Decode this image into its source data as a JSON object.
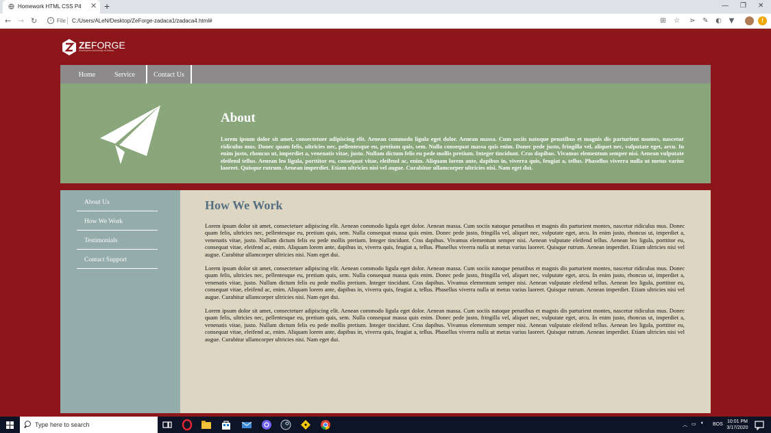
{
  "browser": {
    "tab_title": "Homework HTML CSS P4",
    "tab_close": "✕",
    "new_tab": "+",
    "scheme_label": "File",
    "url": "C:/Users/ALeN/Desktop/ZeForge-zadaca1/zadaca4.html#",
    "back": "←",
    "forward": "→",
    "reload": "↻"
  },
  "window_controls": {
    "minimize": "—",
    "restore": "❐",
    "close": "✕"
  },
  "logo": {
    "brand_bold": "ZE",
    "brand_rest": "FORGE",
    "tagline": "Developers community of Zenica"
  },
  "nav": {
    "items": [
      "Home",
      "Service",
      "Contact Us"
    ]
  },
  "hero": {
    "title": "About",
    "text": "Lorem ipsum dolor sit amet, consectetuer adipiscing elit. Aenean commodo ligula eget dolor. Aenean massa. Cum sociis natoque penatibus et magnis dis parturient montes, nascetur ridiculus mus. Donec quam felis, ultricies nec, pellentesque eu, pretium quis, sem. Nulla consequat massa quis enim. Donec pede justo, fringilla vel, aliquet nec, vulputate eget, arcu. In enim justo, rhoncus ut, imperdiet a, venenatis vitae, justo. Nullam dictum felis eu pede mollis pretium. Integer tincidunt. Cras dapibus. Vivamus elementum semper nisi. Aenean vulputate eleifend tellus. Aenean leo ligula, porttitor eu, consequat vitae, eleifend ac, enim. Aliquam lorem ante, dapibus in, viverra quis, feugiat a, tellus. Phasellus viverra nulla ut metus varius laoreet. Quisque rutrum. Aenean imperdiet. Etiam ultricies nisi vel augue. Curabitur ullamcorper ultricies nisi. Nam eget dui."
  },
  "sidebar": {
    "links": [
      "About Us",
      "How We Work",
      "Testimonials",
      "Contact Support"
    ]
  },
  "main": {
    "heading": "How We Work",
    "paragraphs": [
      "Lorem ipsum dolor sit amet, consectetuer adipiscing elit. Aenean commodo ligula eget dolor. Aenean massa. Cum sociis natoque penatibus et magnis dis parturient montes, nascetur ridiculus mus. Donec quam felis, ultricies nec, pellentesque eu, pretium quis, sem. Nulla consequat massa quis enim. Donec pede justo, fringilla vel, aliquet nec, vulputate eget, arcu. In enim justo, rhoncus ut, imperdiet a, venenatis vitae, justo. Nullam dictum felis eu pede mollis pretium. Integer tincidunt. Cras dapibus. Vivamus elementum semper nisi. Aenean vulputate eleifend tellus. Aenean leo ligula, porttitor eu, consequat vitae, eleifend ac, enim. Aliquam lorem ante, dapibus in, viverra quis, feugiat a, tellus. Phasellus viverra nulla ut metus varius laoreet. Quisque rutrum. Aenean imperdiet. Etiam ultricies nisi vel augue. Curabitur ullamcorper ultricies nisi. Nam eget dui.",
      "Lorem ipsum dolor sit amet, consectetuer adipiscing elit. Aenean commodo ligula eget dolor. Aenean massa. Cum sociis natoque penatibus et magnis dis parturient montes, nascetur ridiculus mus. Donec quam felis, ultricies nec, pellentesque eu, pretium quis, sem. Nulla consequat massa quis enim. Donec pede justo, fringilla vel, aliquet nec, vulputate eget, arcu. In enim justo, rhoncus ut, imperdiet a, venenatis vitae, justo. Nullam dictum felis eu pede mollis pretium. Integer tincidunt. Cras dapibus. Vivamus elementum semper nisi. Aenean vulputate eleifend tellus. Aenean leo ligula, porttitor eu, consequat vitae, eleifend ac, enim. Aliquam lorem ante, dapibus in, viverra quis, feugiat a, tellus. Phasellus viverra nulla ut metus varius laoreet. Quisque rutrum. Aenean imperdiet. Etiam ultricies nisi vel augue. Curabitur ullamcorper ultricies nisi. Nam eget dui.",
      "Lorem ipsum dolor sit amet, consectetuer adipiscing elit. Aenean commodo ligula eget dolor. Aenean massa. Cum sociis natoque penatibus et magnis dis parturient montes, nascetur ridiculus mus. Donec quam felis, ultricies nec, pellentesque eu, pretium quis, sem. Nulla consequat massa quis enim. Donec pede justo, fringilla vel, aliquet nec, vulputate eget, arcu. In enim justo, rhoncus ut, imperdiet a, venenatis vitae, justo. Nullam dictum felis eu pede mollis pretium. Integer tincidunt. Cras dapibus. Vivamus elementum semper nisi. Aenean vulputate eleifend tellus. Aenean leo ligula, porttitor eu, consequat vitae, eleifend ac, enim. Aliquam lorem ante, dapibus in, viverra quis, feugiat a, tellus. Phasellus viverra nulla ut metus varius laoreet. Quisque rutrum. Aenean imperdiet. Etiam ultricies nisi vel augue. Curabitur ullamcorper ultricies nisi. Nam eget dui."
    ]
  },
  "taskbar": {
    "search_placeholder": "Type here to search",
    "language": "BOS",
    "time": "10:01 PM",
    "date": "3/17/2020"
  },
  "colors": {
    "page_bg": "#8c161a",
    "nav_bg": "#8c8a8a",
    "hero_bg": "#8aa77c",
    "sidebar_bg": "#94acaa",
    "main_bg": "#dcd6c2",
    "heading": "#566e82"
  },
  "icons": {
    "hero": "paper-plane-icon",
    "logo": "zeforge-logo-icon"
  }
}
